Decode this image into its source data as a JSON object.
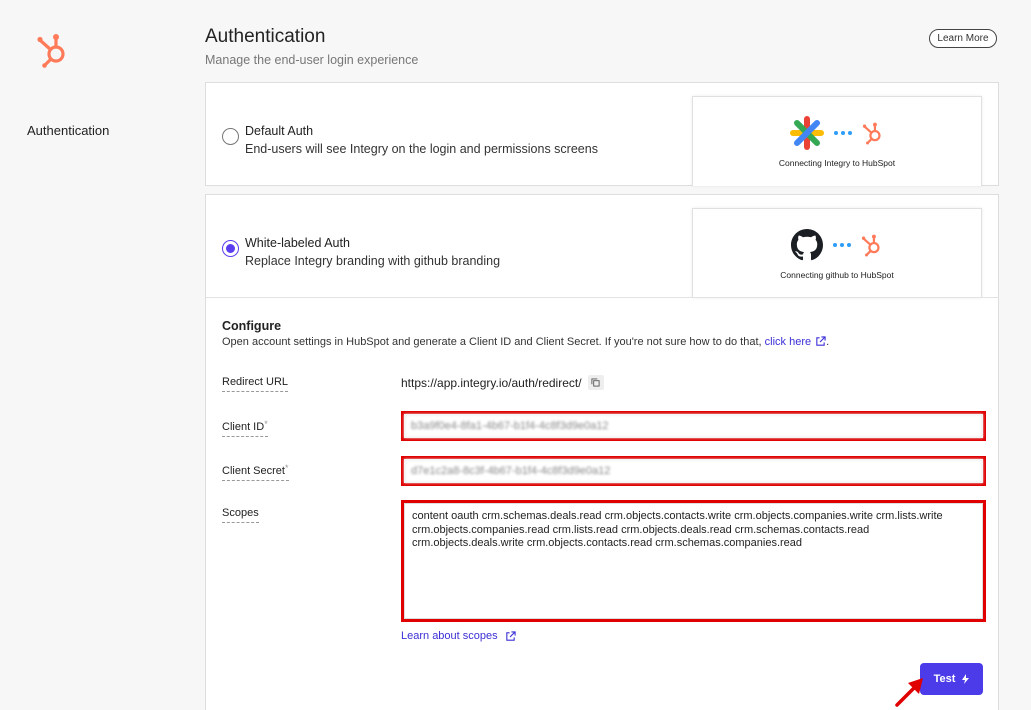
{
  "sidebar": {
    "section_label": "Authentication"
  },
  "header": {
    "title": "Authentication",
    "subtitle": "Manage the end-user login experience",
    "learn_more_label": "Learn More"
  },
  "options": {
    "default": {
      "title": "Default Auth",
      "description": "End-users will see Integry on the login and permissions screens",
      "selected": false,
      "preview_caption": "Connecting Integry to HubSpot"
    },
    "white_labeled": {
      "title": "White-labeled Auth",
      "description": "Replace Integry branding with github branding",
      "selected": true,
      "preview_caption": "Connecting github to HubSpot"
    }
  },
  "configure": {
    "title": "Configure",
    "description": "Open account settings in HubSpot and generate a Client ID and Client Secret. If you're not sure how to do that, ",
    "link_label": "click here",
    "trailing": ".",
    "fields": {
      "redirect_url": {
        "label": "Redirect URL",
        "value": "https://app.integry.io/auth/redirect/"
      },
      "client_id": {
        "label": "Client ID",
        "required_mark": "*",
        "value": "b3a9f0e4-8fa1-4b67-b1f4-4c8f3d9e0a12"
      },
      "client_secret": {
        "label": "Client Secret",
        "required_mark": "*",
        "value": "d7e1c2a8-8c3f-4b67-b1f4-4c8f3d9e0a12"
      },
      "scopes": {
        "label": "Scopes",
        "value": "content oauth crm.schemas.deals.read crm.objects.contacts.write crm.objects.companies.write crm.lists.write crm.objects.companies.read crm.lists.read crm.objects.deals.read crm.schemas.contacts.read crm.objects.deals.write crm.objects.contacts.read crm.schemas.companies.read"
      }
    },
    "scopes_link_label": "Learn about scopes",
    "test_label": "Test"
  },
  "colors": {
    "accent": "#4b3be8",
    "link": "#3b2fd6",
    "highlight": "#e00000",
    "hubspot": "#ff7a59",
    "connector_dots": "#2e9df7"
  },
  "icons": {
    "logo": "hubspot-logo-icon",
    "default_preview": "integry-logo-icon",
    "white_labeled_preview": "github-logo-icon",
    "copy": "copy-icon",
    "external": "external-link-icon",
    "test": "lightning-icon",
    "annotation": "red-arrow-icon"
  }
}
